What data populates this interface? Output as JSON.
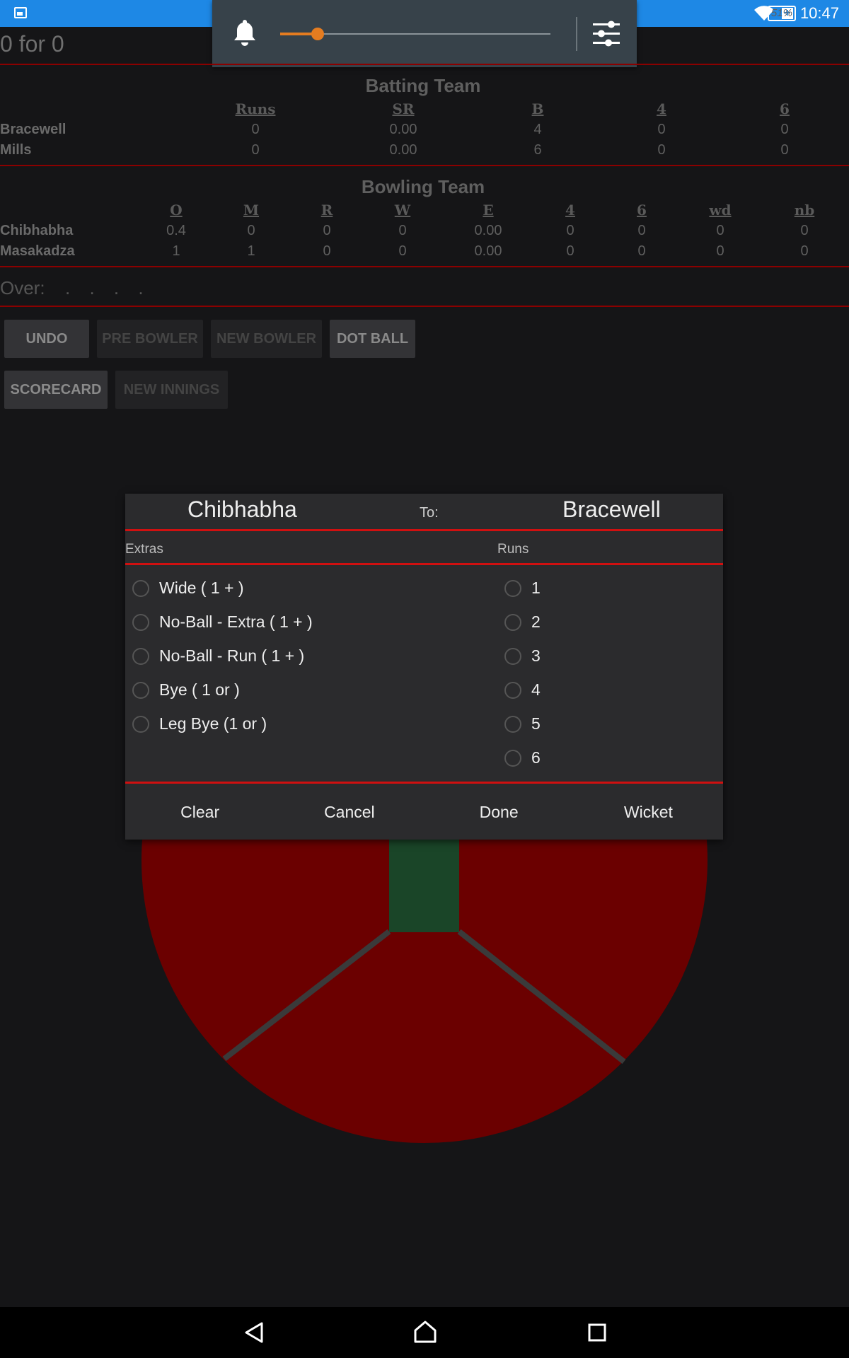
{
  "status_bar": {
    "battery": "51%",
    "time": "10:47",
    "icons": [
      "image-icon",
      "wifi-icon",
      "battery-charging-icon"
    ]
  },
  "volume_panel": {
    "level_percent": 14,
    "icons": [
      "bell-icon",
      "sliders-icon"
    ]
  },
  "score": "0 for 0",
  "batting": {
    "title": "Batting Team",
    "columns": [
      "Runs",
      "SR",
      "B",
      "4",
      "6"
    ],
    "rows": [
      {
        "name": "Bracewell",
        "values": [
          "0",
          "0.00",
          "4",
          "0",
          "0"
        ]
      },
      {
        "name": "Mills",
        "values": [
          "0",
          "0.00",
          "6",
          "0",
          "0"
        ]
      }
    ]
  },
  "bowling": {
    "title": "Bowling Team",
    "columns": [
      "O",
      "M",
      "R",
      "W",
      "E",
      "4",
      "6",
      "wd",
      "nb"
    ],
    "rows": [
      {
        "name": "Chibhabha",
        "values": [
          "0.4",
          "0",
          "0",
          "0",
          "0.00",
          "0",
          "0",
          "0",
          "0"
        ]
      },
      {
        "name": "Masakadza",
        "values": [
          "1",
          "1",
          "0",
          "0",
          "0.00",
          "0",
          "0",
          "0",
          "0"
        ]
      }
    ]
  },
  "over": {
    "label": "Over:",
    "balls": ". . . ."
  },
  "buttons": {
    "undo": "UNDO",
    "pre_bowler": "PRE BOWLER",
    "new_bowler": "NEW BOWLER",
    "dot_ball": "DOT BALL",
    "scorecard": "SCORECARD",
    "new_innings": "NEW INNINGS"
  },
  "colors": {
    "field": "#6b0000",
    "pitch": "#1a4528",
    "accent_red": "#d01010"
  },
  "dialog": {
    "bowler": "Chibhabha",
    "to_label": "To:",
    "batsman": "Bracewell",
    "extras_header": "Extras",
    "runs_header": "Runs",
    "extras": [
      "Wide ( 1 + )",
      "No-Ball - Extra ( 1 + )",
      "No-Ball - Run ( 1 + )",
      "Bye ( 1 or )",
      "Leg Bye (1 or )"
    ],
    "runs": [
      "1",
      "2",
      "3",
      "4",
      "5",
      "6"
    ],
    "actions": {
      "clear": "Clear",
      "cancel": "Cancel",
      "done": "Done",
      "wicket": "Wicket"
    }
  }
}
